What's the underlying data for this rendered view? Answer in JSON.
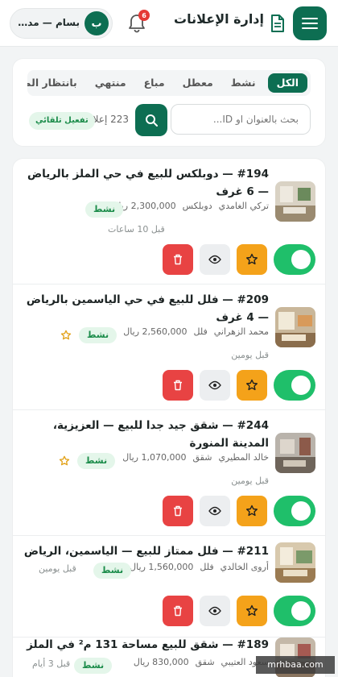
{
  "header": {
    "title": "إدارة الإعلانات",
    "notifications_count": "6",
    "user_initial": "ب",
    "user_name": "بسام — مدي..."
  },
  "filters": {
    "tabs": [
      {
        "label": "الكل",
        "active": true
      },
      {
        "label": "نشط",
        "active": false
      },
      {
        "label": "معطل",
        "active": false
      },
      {
        "label": "مباع",
        "active": false
      },
      {
        "label": "منتهي",
        "active": false
      },
      {
        "label": "بانتظار المرا",
        "active": false
      }
    ],
    "search_placeholder": "بحث بالعنوان او ID...",
    "count_text": "223 إعلان",
    "auto_label": "تفعيل تلقائي"
  },
  "listings": [
    {
      "title": "#194 — دوبلكس للبيع في حي الملز بالرياض — 6 غرف",
      "agent": "تركي الغامدي",
      "type": "دوبلكس",
      "price": "2,300,000 ريال",
      "status": "نشط",
      "featured": false,
      "time": "قبل 10 ساعات"
    },
    {
      "title": "#209 — فلل للبيع في حي الياسمين بالرياض — 4 غرف",
      "agent": "محمد الزهراني",
      "type": "فلل",
      "price": "2,560,000 ريال",
      "status": "نشط",
      "featured": true,
      "time": "قبل يومين"
    },
    {
      "title": "#244 — شقق جيد جدا للبيع — العزيزية، المدينة المنورة",
      "agent": "خالد المطيري",
      "type": "شقق",
      "price": "1,070,000 ريال",
      "status": "نشط",
      "featured": true,
      "time": "قبل يومين"
    },
    {
      "title": "#211 — فلل ممتاز للبيع — الياسمين، الرياض",
      "agent": "أروى الخالدي",
      "type": "فلل",
      "price": "1,560,000 ريال",
      "status": "نشط",
      "featured": false,
      "time": "قبل يومين"
    },
    {
      "title": "#189 — شقق للبيع مساحة 131 م² في الملز",
      "agent": "سعود العتيبي",
      "type": "شقق",
      "price": "830,000 ريال",
      "status": "نشط",
      "featured": false,
      "time": "قبل 3 أيام"
    }
  ],
  "watermark": "mrhbaa.com",
  "colors": {
    "brand": "#0d6e52",
    "toggle_on": "#1fbf6a",
    "star": "#f4a21a",
    "delete": "#e84343",
    "status_bg": "#e4f6ea",
    "status_text": "#1b8c4a"
  },
  "icons": [
    "menu-icon",
    "document-icon",
    "bell-icon",
    "search-icon",
    "star-icon",
    "eye-icon",
    "trash-icon"
  ]
}
